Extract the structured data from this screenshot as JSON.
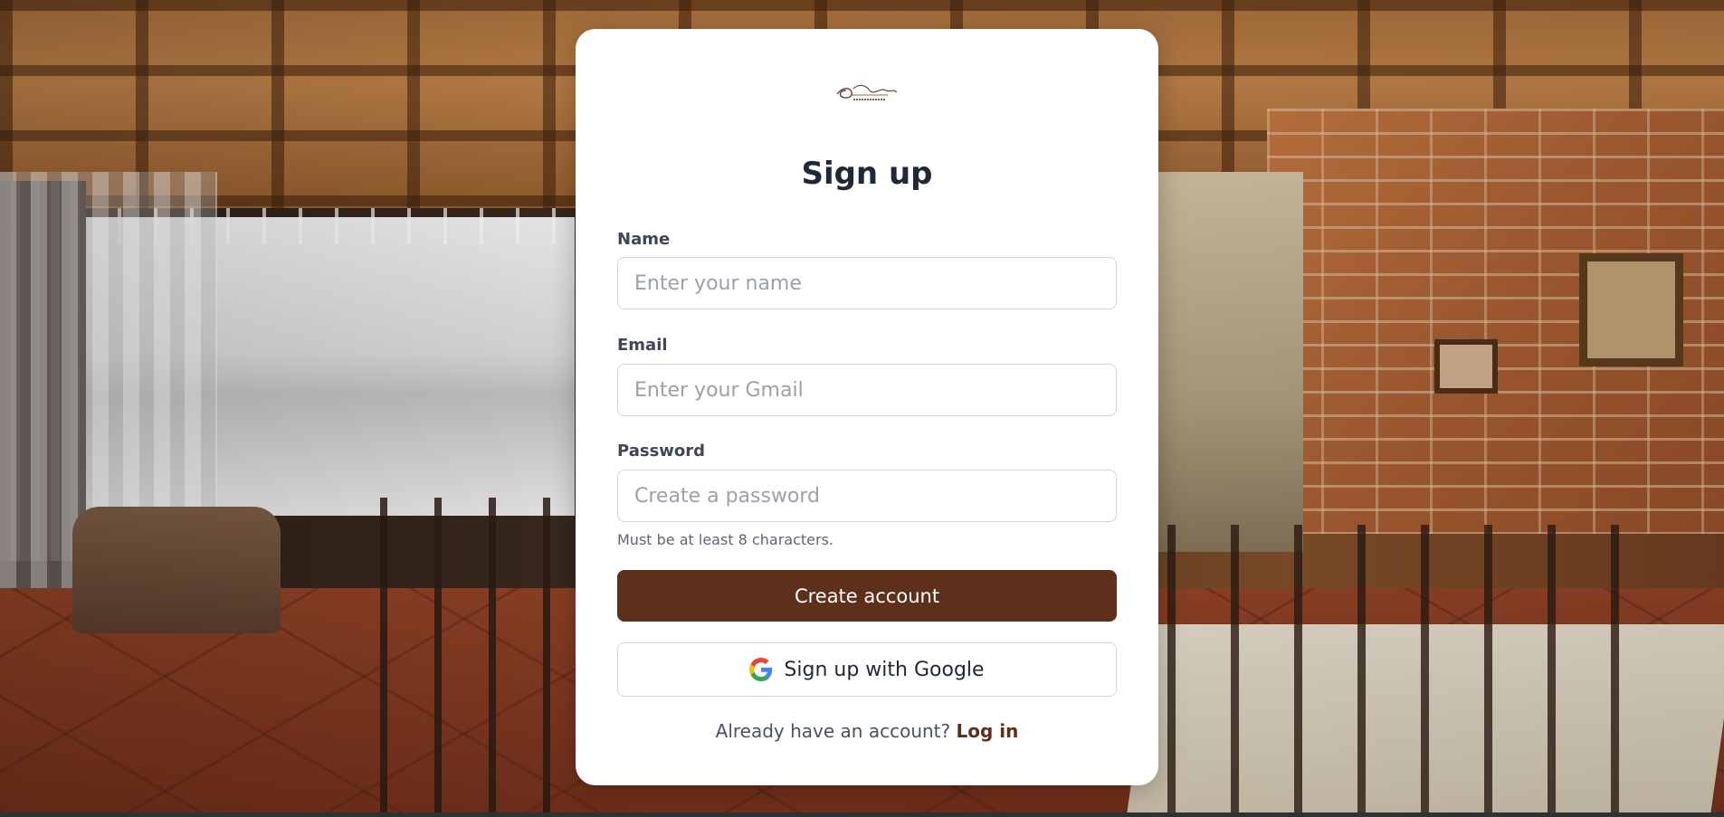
{
  "logo": {
    "text": "OliveBranch",
    "tagline": "AWARD-WINNING"
  },
  "form": {
    "title": "Sign up",
    "name": {
      "label": "Name",
      "placeholder": "Enter your name",
      "value": ""
    },
    "email": {
      "label": "Email",
      "placeholder": "Enter your Gmail",
      "value": ""
    },
    "password": {
      "label": "Password",
      "placeholder": "Create a password",
      "value": "",
      "hint": "Must be at least 8 characters."
    },
    "submit_label": "Create account",
    "google_label": "Sign up with Google",
    "footer_prefix": "Already have an account?",
    "login_label": "Log in"
  },
  "colors": {
    "brand": "#5e2f1b",
    "title": "#1e2838",
    "label": "#3f4756",
    "border": "#d2d6dc"
  },
  "icons": {
    "google": "google-g-icon"
  }
}
